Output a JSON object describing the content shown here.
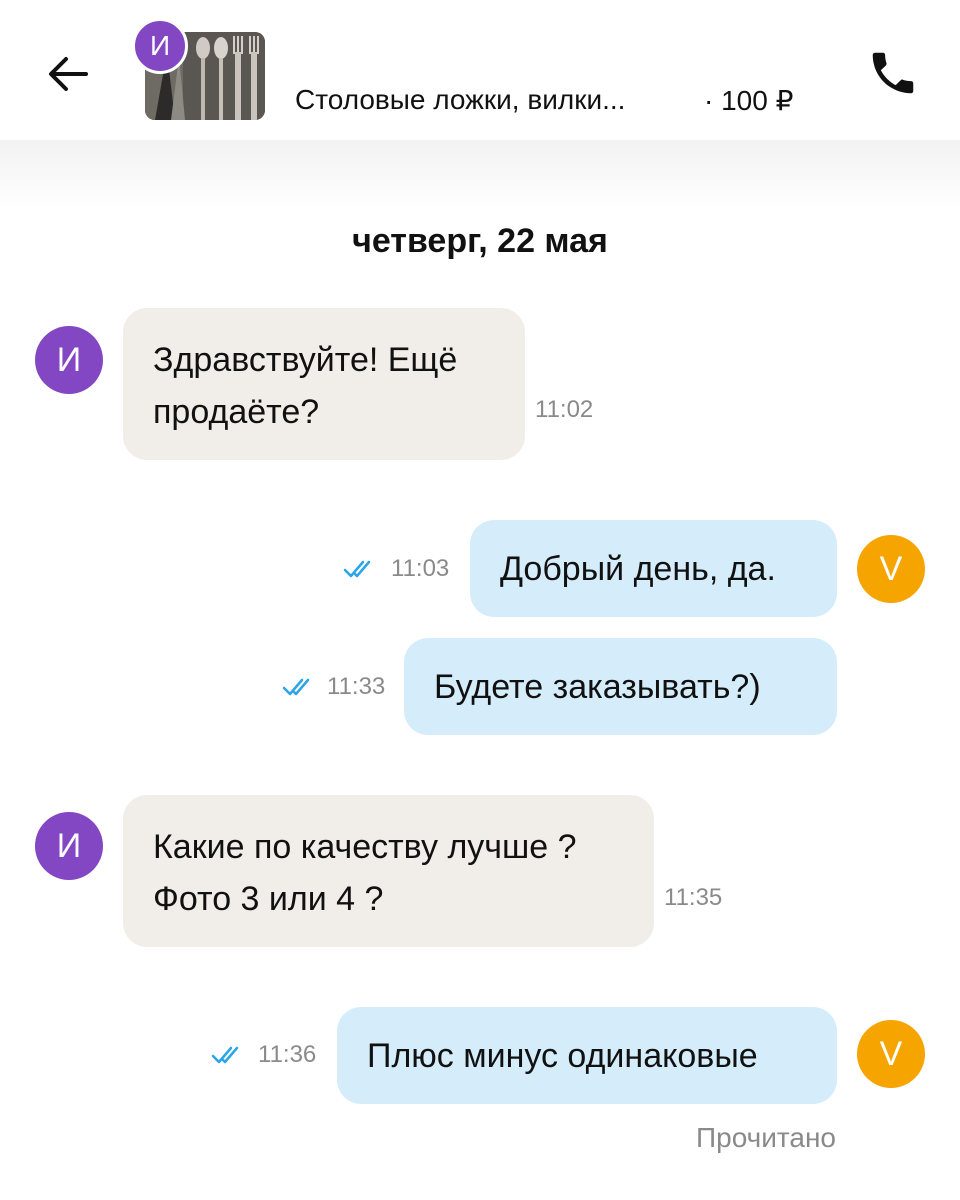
{
  "header": {
    "thumb_avatar_letter": "И",
    "item_title": "Столовые ложки, вилки...",
    "item_price": "· 100 ₽",
    "icons": {
      "back": "arrow-left-icon",
      "call": "phone-icon"
    }
  },
  "date_separator": "четверг, 22 мая",
  "messages": [
    {
      "direction": "in",
      "avatar": "И",
      "lines": [
        "Здравствуйте! Ещё",
        "продаёте?"
      ],
      "time": "11:02"
    },
    {
      "direction": "out",
      "avatar": "V",
      "text": "Добрый день, да.",
      "time": "11:03",
      "read": true
    },
    {
      "direction": "out",
      "text": "Будете заказывать?)",
      "time": "11:33",
      "read": true
    },
    {
      "direction": "in",
      "avatar": "И",
      "lines": [
        "Какие по качеству лучше ?",
        "Фото 3 или 4 ?"
      ],
      "time": "11:35"
    },
    {
      "direction": "out",
      "avatar": "V",
      "text": "Плюс минус одинаковые",
      "time": "11:36",
      "read": true
    }
  ],
  "read_status": "Прочитано",
  "colors": {
    "incoming_bubble": "#f1eee9",
    "outgoing_bubble": "#d5edfb",
    "avatar_incoming": "#8447c4",
    "avatar_outgoing": "#f5a400",
    "read_ticks": "#2aa6e8"
  }
}
